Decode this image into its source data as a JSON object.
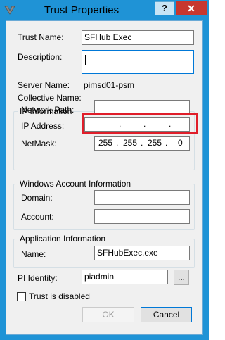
{
  "window": {
    "title": "Trust Properties",
    "help_glyph": "?",
    "close_glyph": "✕"
  },
  "fields": {
    "trust_name": {
      "label": "Trust Name:",
      "value": "SFHub Exec"
    },
    "description": {
      "label": "Description:",
      "value": ""
    },
    "server_name": {
      "label": "Server Name:",
      "value": "pimsd01-psm"
    },
    "collective_name": {
      "label": "Collective Name:",
      "value": ""
    }
  },
  "ip_info": {
    "title": "IP Information",
    "network_path": {
      "label": "Network Path:",
      "value": ""
    },
    "ip_address": {
      "label": "IP Address:",
      "octets": [
        "",
        "",
        "",
        ""
      ],
      "dot": "."
    },
    "netmask": {
      "label": "NetMask:",
      "octets": [
        "255",
        "255",
        "255",
        "0"
      ],
      "dot": "."
    }
  },
  "windows_account": {
    "title": "Windows Account Information",
    "domain": {
      "label": "Domain:",
      "value": ""
    },
    "account": {
      "label": "Account:",
      "value": ""
    }
  },
  "app_info": {
    "title": "Application Information",
    "name": {
      "label": "Name:",
      "value": "SFHubExec.exe"
    }
  },
  "pi_identity": {
    "label": "PI Identity:",
    "value": "piadmin",
    "browse_label": "..."
  },
  "trust_disabled": {
    "label": "Trust is disabled",
    "checked": false
  },
  "buttons": {
    "ok": "OK",
    "cancel": "Cancel"
  },
  "colors": {
    "accent": "#1f93d6",
    "highlight": "#e01e2a",
    "close": "#c7372f"
  }
}
